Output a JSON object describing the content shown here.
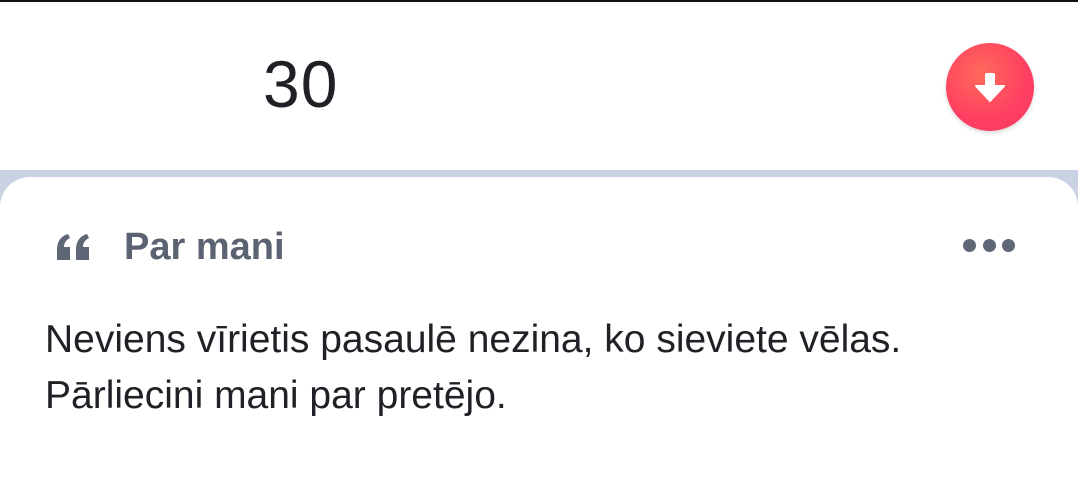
{
  "profile": {
    "age": "30"
  },
  "actions": {
    "down_icon": "arrow-down-icon",
    "down_color": "#ff4060"
  },
  "about_card": {
    "title": "Par mani",
    "quote_icon": "quote-icon",
    "more_icon": "more-icon",
    "text": "Neviens vīrietis pasaulē nezina, ko sieviete vēlas. Pārliecini mani par pretējo."
  },
  "colors": {
    "background_band": "#cdd5e6",
    "card": "#ffffff",
    "title_text": "#5b6272",
    "body_text": "#1f2126"
  }
}
